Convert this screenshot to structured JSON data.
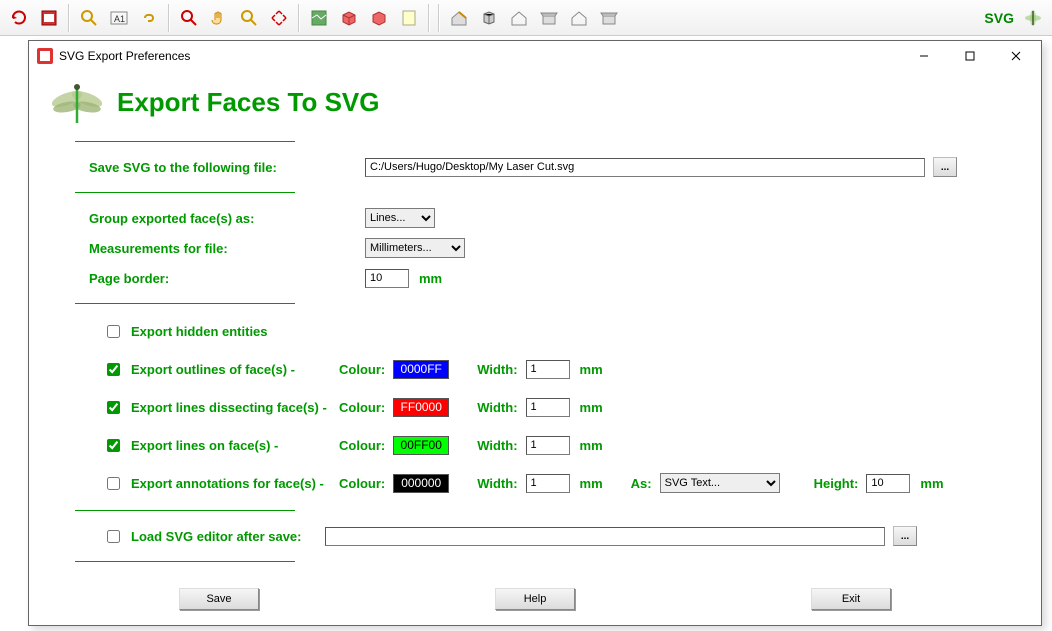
{
  "toolbar": {
    "svg_label": "SVG"
  },
  "dialog": {
    "title": "SVG Export Preferences",
    "heading": "Export Faces To SVG",
    "labels": {
      "save_file": "Save SVG to the following file:",
      "group_as": "Group exported face(s) as:",
      "measurements": "Measurements for file:",
      "page_border": "Page border:",
      "export_hidden": "Export hidden entities",
      "export_outlines": "Export outlines of face(s) -",
      "export_dissect": "Export lines dissecting face(s) -",
      "export_lines_on": "Export lines on face(s) -",
      "export_annotations": "Export annotations for face(s) -",
      "load_editor": "Load SVG editor after save:",
      "colour": "Colour:",
      "width": "Width:",
      "as": "As:",
      "height": "Height:",
      "mm": "mm",
      "browse": "..."
    },
    "values": {
      "file_path": "C:/Users/Hugo/Desktop/My Laser Cut.svg",
      "group_as": "Lines...",
      "measurements": "Millimeters...",
      "page_border": "10",
      "outlines_color": "0000FF",
      "outlines_width": "1",
      "dissect_color": "FF0000",
      "dissect_width": "1",
      "lineson_color": "00FF00",
      "lineson_width": "1",
      "annot_color": "000000",
      "annot_width": "1",
      "annot_as": "SVG Text...",
      "annot_height": "10",
      "editor_path": ""
    },
    "checks": {
      "hidden": false,
      "outlines": true,
      "dissect": true,
      "lineson": true,
      "annotations": false,
      "load_editor": false
    },
    "colors": {
      "outlines_bg": "#0000FF",
      "outlines_fg": "#ffffff",
      "dissect_bg": "#FF0000",
      "dissect_fg": "#ffffff",
      "lineson_bg": "#00FF00",
      "lineson_fg": "#000000",
      "annot_bg": "#000000",
      "annot_fg": "#ffffff"
    },
    "buttons": {
      "save": "Save",
      "help": "Help",
      "exit": "Exit"
    }
  }
}
